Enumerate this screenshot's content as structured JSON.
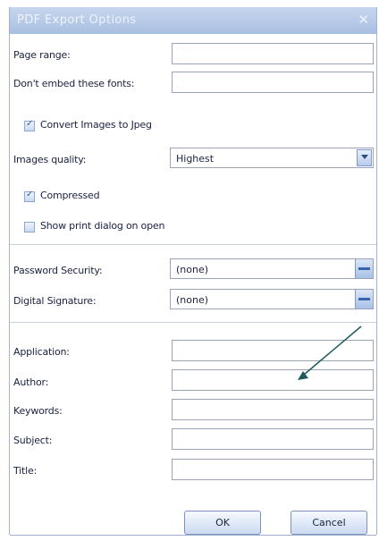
{
  "window": {
    "title": "PDF Export Options",
    "close_icon": "close-icon"
  },
  "fields": {
    "page_range": {
      "label": "Page range:",
      "value": ""
    },
    "dont_embed_fonts": {
      "label": "Don't embed these fonts:",
      "value": ""
    }
  },
  "options": {
    "convert_images": {
      "label": "Convert Images to Jpeg",
      "checked": true
    },
    "images_quality": {
      "label": "Images quality:",
      "value": "Highest"
    },
    "compressed": {
      "label": "Compressed",
      "checked": true
    },
    "show_print_dialog": {
      "label": "Show print dialog on open",
      "checked": false
    }
  },
  "security": {
    "password": {
      "label": "Password Security:",
      "value": "(none)"
    },
    "signature": {
      "label": "Digital Signature:",
      "value": "(none)"
    }
  },
  "metadata": {
    "application": {
      "label": "Application:",
      "value": ""
    },
    "author": {
      "label": "Author:",
      "value": ""
    },
    "keywords": {
      "label": "Keywords:",
      "value": ""
    },
    "subject": {
      "label": "Subject:",
      "value": ""
    },
    "title": {
      "label": "Title:",
      "value": ""
    }
  },
  "buttons": {
    "ok": "OK",
    "cancel": "Cancel"
  },
  "colors": {
    "title_bar": "#b6c9e8",
    "accent": "#3a63ad",
    "annotation_arrow": "#1d5a5e"
  }
}
